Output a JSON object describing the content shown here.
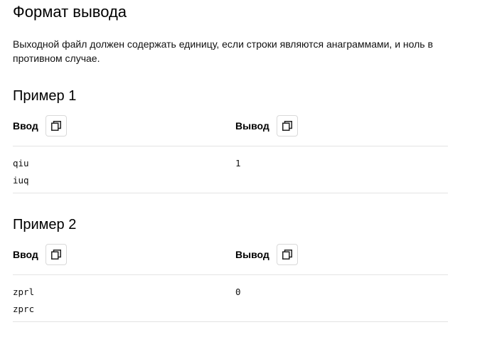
{
  "section": {
    "title": "Формат вывода",
    "description": "Выходной файл должен содержать единицу, если строки являются анаграммами, и ноль в противном случае."
  },
  "examples": [
    {
      "title": "Пример 1",
      "input_label": "Ввод",
      "output_label": "Вывод",
      "input_lines": [
        "qiu",
        "iuq"
      ],
      "output_lines": [
        "1"
      ]
    },
    {
      "title": "Пример 2",
      "input_label": "Ввод",
      "output_label": "Вывод",
      "input_lines": [
        "zprl",
        "zprc"
      ],
      "output_lines": [
        "0"
      ]
    }
  ],
  "icons": {
    "copy": "copy-icon"
  }
}
